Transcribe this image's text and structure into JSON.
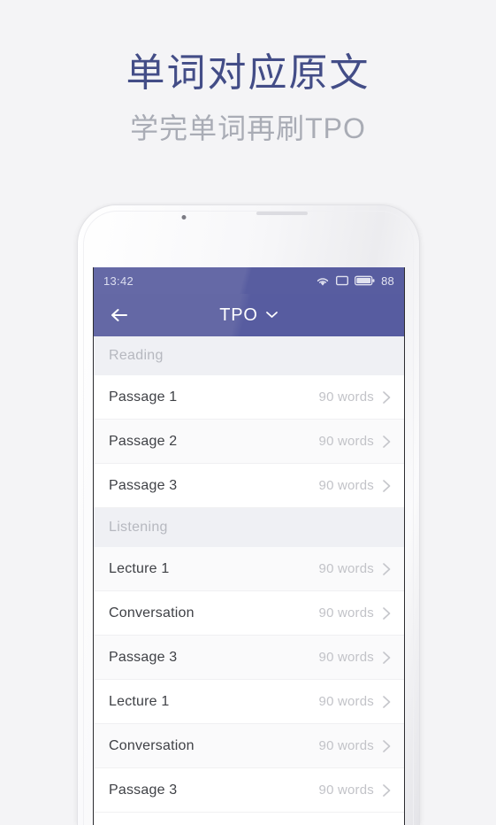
{
  "promo": {
    "title": "单词对应原文",
    "subtitle": "学完单词再刷TPO",
    "title_color": "#434d87",
    "subtitle_color": "#a9acb5"
  },
  "page_background": "#f4f4f6",
  "device": {
    "frame_color": "#f7f7f9",
    "speaker_icon": "speaker-grille-icon",
    "camera_icon": "front-camera-icon"
  },
  "statusbar": {
    "time": "13:42",
    "battery_percent": "88",
    "icons": [
      "wifi-icon",
      "sim-card-icon",
      "battery-icon"
    ],
    "background": "#6569a6"
  },
  "navbar": {
    "back_icon": "back-arrow-icon",
    "title": "TPO",
    "dropdown_icon": "chevron-down-icon",
    "background": "#6468a5",
    "title_color": "#ffffff"
  },
  "list": {
    "meta_suffix": "90 words",
    "chevron_icon": "chevron-right-icon",
    "sections": [
      {
        "header": "Reading",
        "rows": [
          {
            "label": "Passage 1",
            "meta": "90 words"
          },
          {
            "label": "Passage 2",
            "meta": "90 words"
          },
          {
            "label": "Passage 3",
            "meta": "90 words"
          }
        ]
      },
      {
        "header": "Listening",
        "rows": [
          {
            "label": "Lecture 1",
            "meta": "90 words"
          },
          {
            "label": "Conversation",
            "meta": "90 words"
          },
          {
            "label": "Passage 3",
            "meta": "90 words"
          },
          {
            "label": "Lecture 1",
            "meta": "90 words"
          },
          {
            "label": "Conversation",
            "meta": "90 words"
          },
          {
            "label": "Passage 3",
            "meta": "90 words"
          }
        ]
      }
    ]
  }
}
